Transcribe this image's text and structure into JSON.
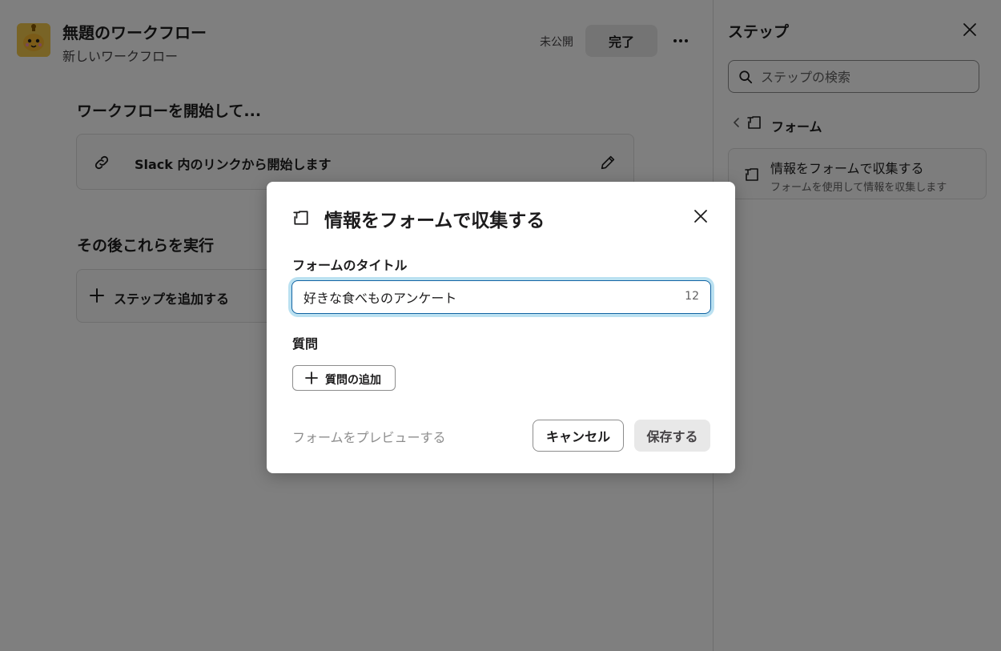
{
  "header": {
    "title": "無題のワークフロー",
    "subtitle": "新しいワークフロー",
    "status": "未公開",
    "done_label": "完了",
    "more_icon": "more-horizontal-icon",
    "app_icon": "robot-avatar-icon"
  },
  "main": {
    "start_heading": "ワークフローを開始して...",
    "trigger": {
      "label": "Slack 内のリンクから開始します",
      "icon": "link-icon",
      "edit_icon": "pencil-icon"
    },
    "then_heading": "その後これらを実行",
    "add_step_label": "ステップを追加する"
  },
  "sidebar": {
    "title": "ステップ",
    "search_placeholder": "ステップの検索",
    "category": "フォーム",
    "items": [
      {
        "title": "情報をフォームで収集する",
        "description": "フォームを使用して情報を収集します",
        "icon": "form-icon"
      }
    ]
  },
  "modal": {
    "title": "情報をフォームで収集する",
    "form_title_label": "フォームのタイトル",
    "form_title_value": "好きな食べものアンケート",
    "char_count": "12",
    "questions_label": "質問",
    "add_question_label": "質問の追加",
    "preview_label": "フォームをプレビューする",
    "cancel_label": "キャンセル",
    "save_label": "保存する"
  },
  "colors": {
    "focus_border": "#1264a3",
    "focus_ring": "#1d9bd1",
    "overlay": "#000000",
    "muted_text": "#8d8d8d"
  }
}
